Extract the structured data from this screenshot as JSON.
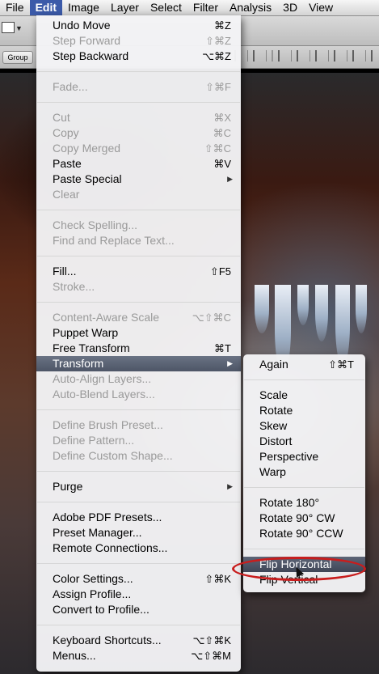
{
  "menubar": {
    "items": [
      {
        "label": "File"
      },
      {
        "label": "Edit"
      },
      {
        "label": "Image"
      },
      {
        "label": "Layer"
      },
      {
        "label": "Select"
      },
      {
        "label": "Filter"
      },
      {
        "label": "Analysis"
      },
      {
        "label": "3D"
      },
      {
        "label": "View"
      }
    ],
    "active": "Edit"
  },
  "toolbar": {
    "group_label": "Group"
  },
  "edit_menu": {
    "items": [
      {
        "label": "Undo Move",
        "shortcut": "⌘Z",
        "enabled": true
      },
      {
        "label": "Step Forward",
        "shortcut": "⇧⌘Z",
        "enabled": false
      },
      {
        "label": "Step Backward",
        "shortcut": "⌥⌘Z",
        "enabled": true
      },
      {
        "label": "Fade...",
        "shortcut": "⇧⌘F",
        "enabled": false
      },
      {
        "label": "Cut",
        "shortcut": "⌘X",
        "enabled": false
      },
      {
        "label": "Copy",
        "shortcut": "⌘C",
        "enabled": false
      },
      {
        "label": "Copy Merged",
        "shortcut": "⇧⌘C",
        "enabled": false
      },
      {
        "label": "Paste",
        "shortcut": "⌘V",
        "enabled": true
      },
      {
        "label": "Paste Special",
        "shortcut": "",
        "enabled": true
      },
      {
        "label": "Clear",
        "shortcut": "",
        "enabled": false
      },
      {
        "label": "Check Spelling...",
        "shortcut": "",
        "enabled": false
      },
      {
        "label": "Find and Replace Text...",
        "shortcut": "",
        "enabled": false
      },
      {
        "label": "Fill...",
        "shortcut": "⇧F5",
        "enabled": true
      },
      {
        "label": "Stroke...",
        "shortcut": "",
        "enabled": false
      },
      {
        "label": "Content-Aware Scale",
        "shortcut": "⌥⇧⌘C",
        "enabled": false
      },
      {
        "label": "Puppet Warp",
        "shortcut": "",
        "enabled": true
      },
      {
        "label": "Free Transform",
        "shortcut": "⌘T",
        "enabled": true
      },
      {
        "label": "Transform",
        "shortcut": "",
        "enabled": true
      },
      {
        "label": "Auto-Align Layers...",
        "shortcut": "",
        "enabled": false
      },
      {
        "label": "Auto-Blend Layers...",
        "shortcut": "",
        "enabled": false
      },
      {
        "label": "Define Brush Preset...",
        "shortcut": "",
        "enabled": false
      },
      {
        "label": "Define Pattern...",
        "shortcut": "",
        "enabled": false
      },
      {
        "label": "Define Custom Shape...",
        "shortcut": "",
        "enabled": false
      },
      {
        "label": "Purge",
        "shortcut": "",
        "enabled": true
      },
      {
        "label": "Adobe PDF Presets...",
        "shortcut": "",
        "enabled": true
      },
      {
        "label": "Preset Manager...",
        "shortcut": "",
        "enabled": true
      },
      {
        "label": "Remote Connections...",
        "shortcut": "",
        "enabled": true
      },
      {
        "label": "Color Settings...",
        "shortcut": "⇧⌘K",
        "enabled": true
      },
      {
        "label": "Assign Profile...",
        "shortcut": "",
        "enabled": true
      },
      {
        "label": "Convert to Profile...",
        "shortcut": "",
        "enabled": true
      },
      {
        "label": "Keyboard Shortcuts...",
        "shortcut": "⌥⇧⌘K",
        "enabled": true
      },
      {
        "label": "Menus...",
        "shortcut": "⌥⇧⌘M",
        "enabled": true
      }
    ]
  },
  "transform_submenu": {
    "items": [
      {
        "label": "Again",
        "shortcut": "⇧⌘T"
      },
      {
        "label": "Scale",
        "shortcut": ""
      },
      {
        "label": "Rotate",
        "shortcut": ""
      },
      {
        "label": "Skew",
        "shortcut": ""
      },
      {
        "label": "Distort",
        "shortcut": ""
      },
      {
        "label": "Perspective",
        "shortcut": ""
      },
      {
        "label": "Warp",
        "shortcut": ""
      },
      {
        "label": "Rotate 180°",
        "shortcut": ""
      },
      {
        "label": "Rotate 90° CW",
        "shortcut": ""
      },
      {
        "label": "Rotate 90° CCW",
        "shortcut": ""
      },
      {
        "label": "Flip Horizontal",
        "shortcut": ""
      },
      {
        "label": "Flip Vertical",
        "shortcut": ""
      }
    ],
    "highlighted": "Flip Horizontal"
  },
  "colors": {
    "menubar_active": "#3b5aa9",
    "highlight": "#5d6577",
    "annotation_oval": "#c81d1d"
  },
  "icons": {
    "submenu_arrow": "▶",
    "tool_dropdown": "▼"
  }
}
